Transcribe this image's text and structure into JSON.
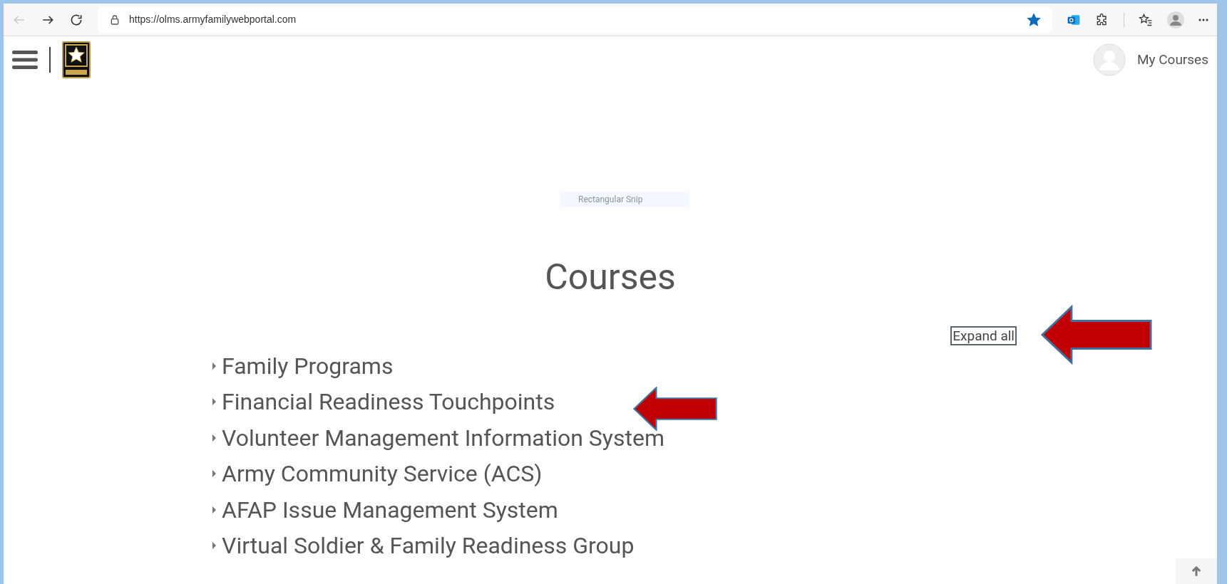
{
  "browser": {
    "url": "https://olms.armyfamilywebportal.com",
    "bookmarked": true
  },
  "header": {
    "user_link": "My Courses"
  },
  "snip_label": "Rectangular Snip",
  "page": {
    "title": "Courses",
    "expand_all": "Expand all",
    "categories": [
      {
        "label": "Family Programs",
        "expanded": false
      },
      {
        "label": "Financial Readiness Touchpoints",
        "expanded": false
      },
      {
        "label": "Volunteer Management Information System",
        "expanded": false
      },
      {
        "label": "Army Community Service (ACS)",
        "expanded": false
      },
      {
        "label": "AFAP Issue Management System",
        "expanded": false
      },
      {
        "label": "Virtual Soldier & Family Readiness Group",
        "expanded": false
      }
    ]
  }
}
